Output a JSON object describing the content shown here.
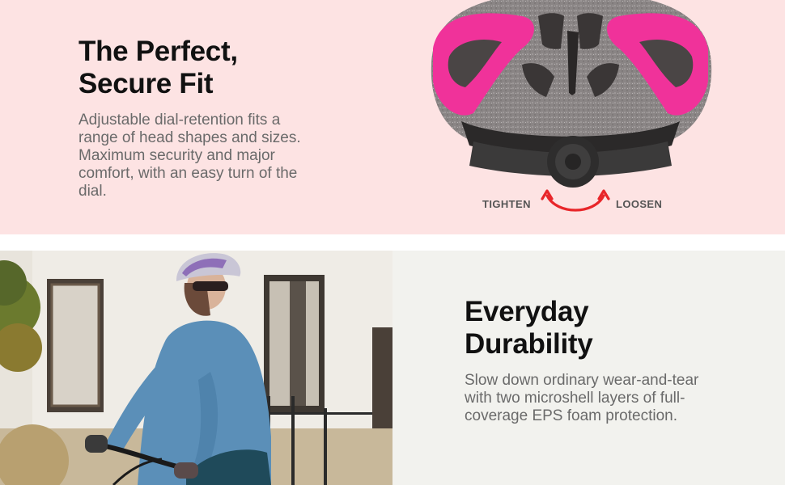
{
  "section_fit": {
    "title_line1": "The Perfect,",
    "title_line2": "Secure Fit",
    "body": "Adjustable dial-retention fits a range of head shapes and sizes. Maximum security and major comfort, with an easy turn of the dial.",
    "label_tighten": "TIGHTEN",
    "label_loosen": "LOOSEN"
  },
  "section_durability": {
    "title_line1": "Everyday",
    "title_line2": "Durability",
    "body": "Slow down ordinary wear-and-tear with two microshell layers of full-coverage EPS foam protection."
  },
  "colors": {
    "top_background": "#fde3e3",
    "bottom_text_background": "#f2f2ee",
    "helmet_pink": "#f0329a",
    "arrow_red": "#e8262a"
  }
}
